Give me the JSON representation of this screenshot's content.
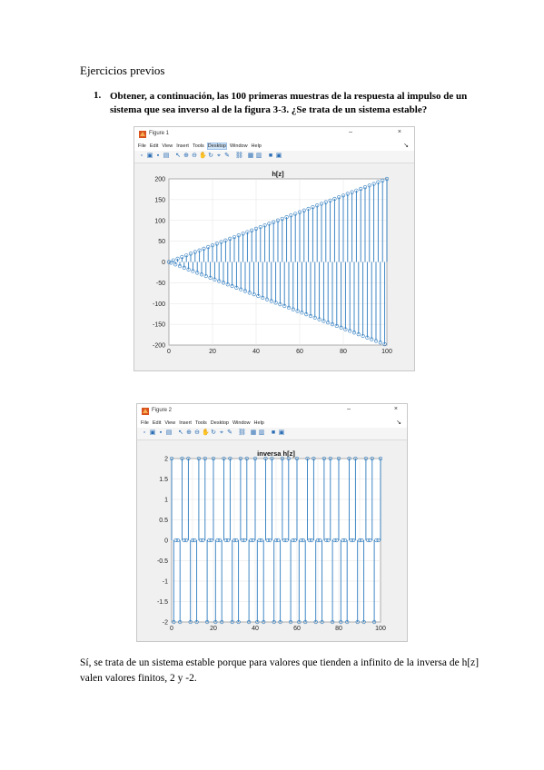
{
  "document": {
    "heading": "Ejercicios previos",
    "question_number": "1.",
    "question_text": "Obtener, a continuación, las 100 primeras muestras de la respuesta al impulso de un sistema que sea inverso al de la figura 3-3. ¿Se trata de un sistema estable?",
    "answer_text": "Sí, se trata de un sistema estable porque para valores que tienden a infinito de la inversa de h[z] valen valores finitos, 2 y -2."
  },
  "figure1": {
    "window_title": "Figure 1",
    "menu": [
      "File",
      "Edit",
      "View",
      "Insert",
      "Tools",
      "Desktop",
      "Window",
      "Help"
    ],
    "highlighted_menu": "Desktop",
    "plot_title": "h[z]"
  },
  "figure2": {
    "window_title": "Figure 2",
    "menu": [
      "File",
      "Edit",
      "View",
      "Insert",
      "Tools",
      "Desktop",
      "Window",
      "Help"
    ],
    "plot_title": "inversa h[z]"
  },
  "window_controls": {
    "minimize": "–",
    "close": "×",
    "dock": "↘"
  },
  "colors": {
    "stem": "#2d7bbf",
    "grid": "#e3e3e3",
    "window": "#f0f0f0"
  },
  "chart_data": [
    {
      "type": "stem",
      "title": "h[z]",
      "xlabel": "",
      "ylabel": "",
      "xlim": [
        0,
        100
      ],
      "ylim": [
        -200,
        200
      ],
      "xticks": [
        0,
        20,
        40,
        60,
        80,
        100
      ],
      "yticks": [
        200,
        150,
        100,
        50,
        0,
        -50,
        -100,
        -150,
        -200
      ],
      "series": [
        {
          "x_start": 0,
          "x_end": 100,
          "values_rule": "alternating +2n / -2n",
          "values_first": [
            0,
            -2,
            4,
            -6,
            8,
            -10
          ],
          "value_at_100": 200
        }
      ],
      "grid": true
    },
    {
      "type": "stem",
      "title": "inversa h[z]",
      "xlabel": "",
      "ylabel": "",
      "xlim": [
        0,
        100
      ],
      "ylim": [
        -2,
        2
      ],
      "xticks": [
        0,
        10,
        20,
        30,
        40,
        50,
        60,
        70,
        80,
        90,
        100
      ],
      "xtick_labels": [
        "0",
        "",
        "20",
        "",
        "40",
        "",
        "60",
        "",
        "80",
        "",
        "100"
      ],
      "yticks": [
        2,
        1.5,
        1,
        0.5,
        0,
        -0.5,
        -1,
        -1.5,
        -2
      ],
      "series": [
        {
          "values_set": [
            -2,
            0,
            2
          ]
        }
      ],
      "grid": true
    }
  ]
}
